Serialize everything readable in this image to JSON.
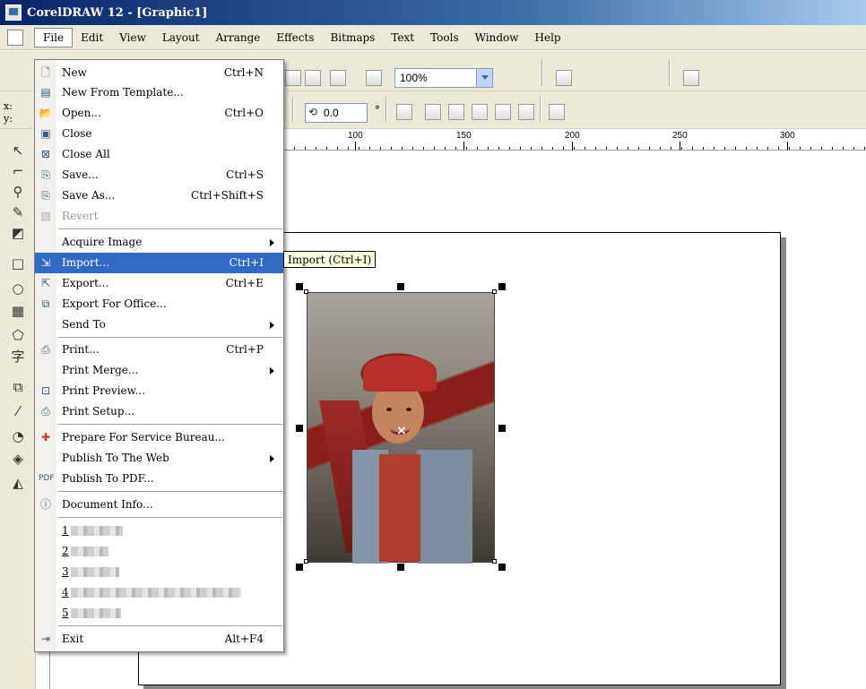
{
  "window": {
    "title": "CorelDRAW 12 - [Graphic1]"
  },
  "menubar": {
    "items": [
      {
        "label": "File"
      },
      {
        "label": "Edit"
      },
      {
        "label": "View"
      },
      {
        "label": "Layout"
      },
      {
        "label": "Arrange"
      },
      {
        "label": "Effects"
      },
      {
        "label": "Bitmaps"
      },
      {
        "label": "Text"
      },
      {
        "label": "Tools"
      },
      {
        "label": "Window"
      },
      {
        "label": "Help"
      }
    ]
  },
  "toolbar": {
    "zoom_value": "100%",
    "rotation_value": "0.0",
    "degree_symbol": "°",
    "coord_x_label": "x:",
    "coord_y_label": "y:"
  },
  "ruler": {
    "ticks": [
      "100",
      "150",
      "200",
      "250",
      "300"
    ]
  },
  "file_menu": {
    "items": [
      {
        "label": "New",
        "shortcut": "Ctrl+N",
        "icon": "new-document-icon"
      },
      {
        "label": "New From Template...",
        "shortcut": "",
        "icon": "template-icon"
      },
      {
        "label": "Open...",
        "shortcut": "Ctrl+O",
        "icon": "open-folder-icon"
      },
      {
        "label": "Close",
        "shortcut": "",
        "icon": "close-document-icon"
      },
      {
        "label": "Close All",
        "shortcut": "",
        "icon": "close-all-icon"
      },
      {
        "label": "Save...",
        "shortcut": "Ctrl+S",
        "icon": "save-icon"
      },
      {
        "label": "Save As...",
        "shortcut": "Ctrl+Shift+S",
        "icon": "save-as-icon"
      },
      {
        "label": "Revert",
        "shortcut": "",
        "icon": "revert-icon",
        "disabled": true
      },
      {
        "label": "Acquire Image",
        "shortcut": "",
        "submenu": true
      },
      {
        "label": "Import...",
        "shortcut": "Ctrl+I",
        "icon": "import-icon",
        "selected": true
      },
      {
        "label": "Export...",
        "shortcut": "Ctrl+E",
        "icon": "export-icon"
      },
      {
        "label": "Export For Office...",
        "shortcut": "",
        "icon": "export-office-icon"
      },
      {
        "label": "Send To",
        "shortcut": "",
        "submenu": true
      },
      {
        "label": "Print...",
        "shortcut": "Ctrl+P",
        "icon": "print-icon"
      },
      {
        "label": "Print Merge...",
        "shortcut": "",
        "submenu": true
      },
      {
        "label": "Print Preview...",
        "shortcut": "",
        "icon": "print-preview-icon"
      },
      {
        "label": "Print Setup...",
        "shortcut": "",
        "icon": "print-setup-icon"
      },
      {
        "label": "Prepare For Service Bureau...",
        "shortcut": "",
        "icon": "service-bureau-icon"
      },
      {
        "label": "Publish To The Web",
        "shortcut": "",
        "submenu": true
      },
      {
        "label": "Publish To PDF...",
        "shortcut": "",
        "icon": "pdf-icon"
      },
      {
        "label": "Document Info...",
        "shortcut": "",
        "icon": "info-icon"
      },
      {
        "label": "1",
        "shortcut": ""
      },
      {
        "label": "2",
        "shortcut": ""
      },
      {
        "label": "3",
        "shortcut": ""
      },
      {
        "label": "4",
        "shortcut": ""
      },
      {
        "label": "5",
        "shortcut": ""
      },
      {
        "label": "Exit",
        "shortcut": "Alt+F4",
        "icon": "exit-icon"
      }
    ]
  },
  "tooltip": {
    "text": "Import (Ctrl+I)"
  },
  "colors": {
    "selection": "#316ac5",
    "title_bar": "#0a246a",
    "menu_bg": "#ece9d8",
    "tooltip_bg": "#ffffe1"
  }
}
